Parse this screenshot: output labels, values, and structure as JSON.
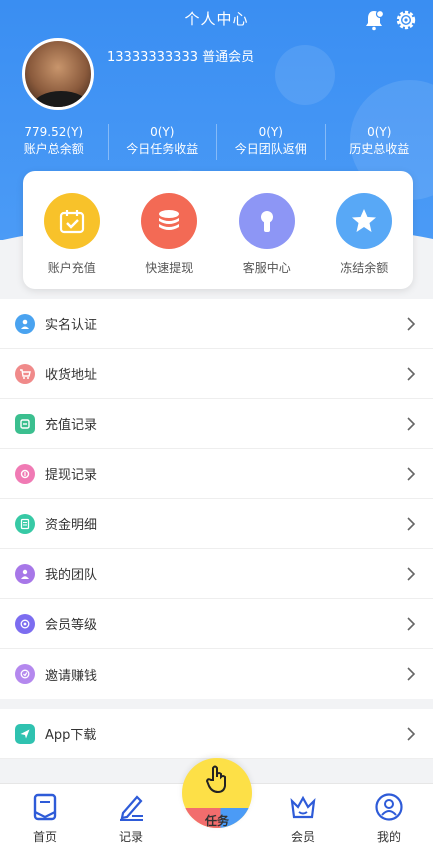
{
  "header": {
    "title": "个人中心",
    "phone": "13333333333",
    "member_level": "普通会员"
  },
  "stats": [
    {
      "value": "779.52(Y)",
      "label": "账户总余额"
    },
    {
      "value": "0(Y)",
      "label": "今日任务收益"
    },
    {
      "value": "0(Y)",
      "label": "今日团队返佣"
    },
    {
      "value": "0(Y)",
      "label": "历史总收益"
    }
  ],
  "actions": [
    {
      "label": "账户充值",
      "icon": "calendar-check-icon",
      "color": "#f8c22a"
    },
    {
      "label": "快速提现",
      "icon": "coin-stack-icon",
      "color": "#f36a55"
    },
    {
      "label": "客服中心",
      "icon": "keyhole-icon",
      "color": "#8d96f5"
    },
    {
      "label": "冻结余额",
      "icon": "star-icon",
      "color": "#58a8f6"
    }
  ],
  "menu": [
    {
      "label": "实名认证",
      "icon": "id-user-icon",
      "color": "#4aa3f0"
    },
    {
      "label": "收货地址",
      "icon": "cart-icon",
      "color": "#f08a8a"
    },
    {
      "label": "充值记录",
      "icon": "wallet-icon",
      "color": "#3bbf8f"
    },
    {
      "label": "提现记录",
      "icon": "withdraw-icon",
      "color": "#f07ab4"
    },
    {
      "label": "资金明细",
      "icon": "ledger-icon",
      "color": "#37c9a5"
    },
    {
      "label": "我的团队",
      "icon": "team-icon",
      "color": "#a777e8"
    },
    {
      "label": "会员等级",
      "icon": "level-icon",
      "color": "#7c6df0"
    },
    {
      "label": "邀请赚钱",
      "icon": "invite-icon",
      "color": "#b488ee"
    }
  ],
  "menu2": [
    {
      "label": "App下载",
      "icon": "paper-plane-icon",
      "color": "#2fc2b0"
    }
  ],
  "tabbar": {
    "home": "首页",
    "records": "记录",
    "task": "任务",
    "member": "会员",
    "mine": "我的"
  }
}
